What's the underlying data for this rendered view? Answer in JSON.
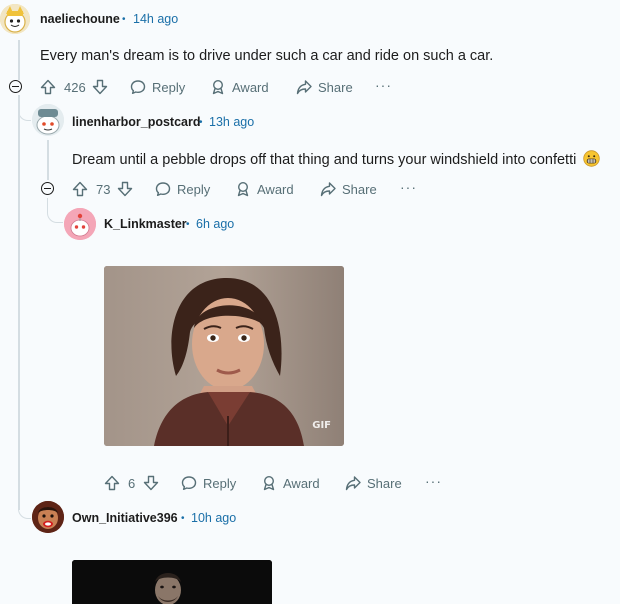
{
  "comments": [
    {
      "username": "naeliechoune",
      "time": "14h ago",
      "text": "Every man's dream is to drive under such a car and ride on such a car.",
      "votes": "426"
    },
    {
      "username": "linenharbor_postcard",
      "time": "13h ago",
      "text": "Dream until a pebble drops off that thing and turns your windshield into confetti",
      "votes": "73"
    },
    {
      "username": "K_Linkmaster",
      "time": "6h ago",
      "gif_badge": "GIF",
      "votes": "6"
    },
    {
      "username": "Own_Initiative396",
      "time": "10h ago"
    }
  ],
  "actions": {
    "reply": "Reply",
    "award": "Award",
    "share": "Share",
    "more": "···"
  },
  "separator": "•",
  "colors": {
    "background": "#f8fbfd",
    "meta_link": "#1a6fa8",
    "action_gray": "#576f76",
    "thread_line": "#d4dde2"
  }
}
